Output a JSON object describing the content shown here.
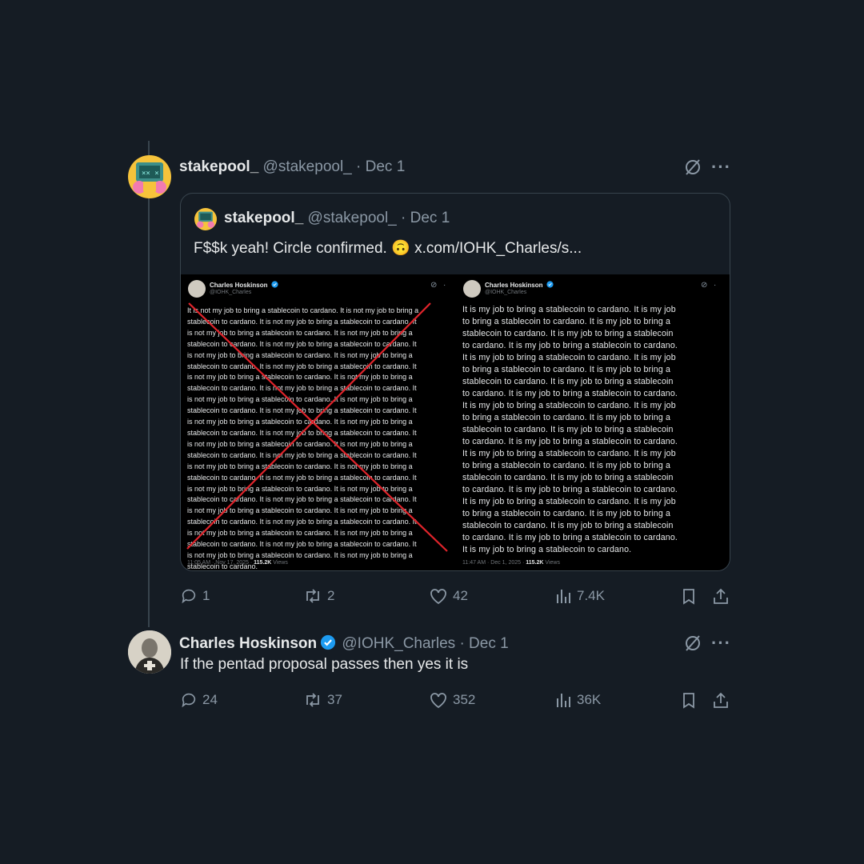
{
  "tweet1": {
    "name": "stakepool_",
    "handle": "@stakepool_",
    "date": "· Dec 1",
    "quote": {
      "name": "stakepool_",
      "handle": "@stakepool_",
      "date": "· Dec 1",
      "text": "F$$k yeah! Circle confirmed.",
      "emoji": "🙃",
      "link": "x.com/IOHK_Charles/s..."
    },
    "image": {
      "left": {
        "name": "Charles Hoskinson",
        "handle": "@IOHK_Charles",
        "body_lines": [
          "It is not my job to bring a stablecoin to cardano. It is not my job to bring a",
          "stablecoin to cardano. It is not my job to bring a stablecoin to cardano. It",
          "is not my job to bring a stablecoin to cardano. It is not my job to bring a",
          "stablecoin to cardano. It is not my job to bring a stablecoin to cardano. It",
          "is not my job to bring a stablecoin to cardano. It is not my job to bring a",
          "stablecoin to cardano. It is not my job to bring a stablecoin to cardano. It",
          "is not my job to bring a stablecoin to cardano. It is not my job to bring a",
          "stablecoin to cardano. It is not my job to bring a stablecoin to cardano. It",
          "is not my job to bring a stablecoin to cardano. It is not my job to bring a",
          "stablecoin to cardano. It is not my job to bring a stablecoin to cardano. It",
          "is not my job to bring a stablecoin to cardano. It is not my job to bring a",
          "stablecoin to cardano. It is not my job to bring a stablecoin to cardano. It",
          "is not my job to bring a stablecoin to cardano. It is not my job to bring a",
          "stablecoin to cardano. It is not my job to bring a stablecoin to cardano. It",
          "is not my job to bring a stablecoin to cardano. It is not my job to bring a",
          "stablecoin to cardano. It is not my job to bring a stablecoin to cardano. It",
          "is not my job to bring a stablecoin to cardano. It is not my job to bring a",
          "stablecoin to cardano. It is not my job to bring a stablecoin to cardano. It",
          "is not my job to bring a stablecoin to cardano. It is not my job to bring a",
          "stablecoin to cardano. It is not my job to bring a stablecoin to cardano. It",
          "is not my job to bring a stablecoin to cardano. It is not my job to bring a",
          "stablecoin to cardano. It is not my job to bring a stablecoin to cardano. It",
          "is not my job to bring a stablecoin to cardano. It is not my job to bring a",
          "stablecoin to cardano."
        ],
        "time": "11:05 AM · Nov 17, 2025 ·",
        "views": "115.2K",
        "views_label": "Views"
      },
      "right": {
        "name": "Charles Hoskinson",
        "handle": "@IOHK_Charles",
        "body_lines": [
          "It is my job to bring a stablecoin to cardano. It is my job",
          "to bring a stablecoin to cardano. It is my job to bring a",
          "stablecoin to cardano. It is my job to bring a stablecoin",
          "to cardano. It is my job to bring a stablecoin to cardano.",
          "It is my job to bring a stablecoin to cardano. It is my job",
          "to bring a stablecoin to cardano. It is my job to bring a",
          "stablecoin to cardano. It is my job to bring a stablecoin",
          "to cardano. It is my job to bring a stablecoin to cardano.",
          "It is my job to bring a stablecoin to cardano. It is my job",
          "to bring a stablecoin to cardano. It is my job to bring a",
          "stablecoin to cardano. It is my job to bring a stablecoin",
          "to cardano. It is my job to bring a stablecoin to cardano.",
          "It is my job to bring a stablecoin to cardano. It is my job",
          "to bring a stablecoin to cardano. It is my job to bring a",
          "stablecoin to cardano. It is my job to bring a stablecoin",
          "to cardano. It is my job to bring a stablecoin to cardano.",
          "It is my job to bring a stablecoin to cardano. It is my job",
          "to bring a stablecoin to cardano. It is my job to bring a",
          "stablecoin to cardano. It is my job to bring a stablecoin",
          "to cardano. It is my job to bring a stablecoin to cardano.",
          "It is my job to bring a stablecoin to cardano."
        ],
        "time": "11:47 AM · Dec 1, 2025 ·",
        "views": "115.2K",
        "views_label": "Views"
      }
    },
    "stats": {
      "replies": "1",
      "reposts": "2",
      "likes": "42",
      "views": "7.4K"
    }
  },
  "tweet2": {
    "name": "Charles Hoskinson",
    "handle": "@IOHK_Charles",
    "date": "· Dec 1",
    "text": "If the pentad proposal passes then yes it is",
    "stats": {
      "replies": "24",
      "reposts": "37",
      "likes": "352",
      "views": "36K"
    }
  },
  "colors": {
    "background": "#151c24",
    "muted": "#8b98a5",
    "verified": "#1d9bf0",
    "cross_out": "#e0242b"
  },
  "icons": [
    "grok-icon",
    "more-icon",
    "reply-icon",
    "repost-icon",
    "like-icon",
    "views-icon",
    "bookmark-icon",
    "share-icon",
    "verified-badge-icon"
  ]
}
